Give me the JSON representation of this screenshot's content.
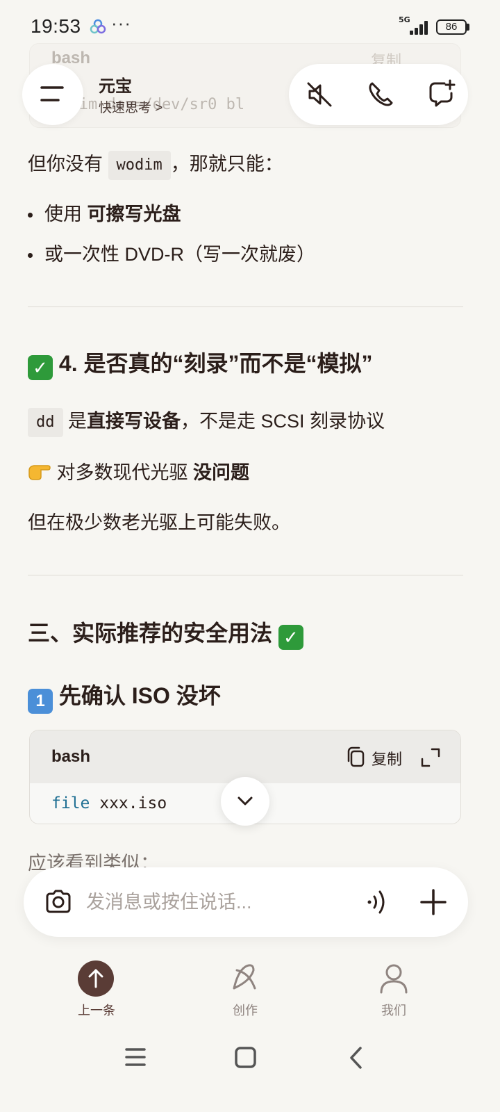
{
  "status_bar": {
    "time": "19:53",
    "more": "···",
    "network": "5G",
    "battery": "86"
  },
  "ghost": {
    "lang": "bash",
    "copy": "复制",
    "code": "wodim dev=/dev/sr0 bl"
  },
  "header": {
    "title": "元宝",
    "subtitle": "快速思考 >"
  },
  "content": {
    "p1_prefix": "但你没有",
    "p1_code": "wodim",
    "p1_suffix": "，那就只能：",
    "bullet1_prefix": "使用 ",
    "bullet1_bold": "可擦写光盘",
    "bullet2": "或一次性 DVD-R（写一次就废）",
    "h4_title": "4. 是否真的“刻录”而不是“模拟”",
    "p2_code": "dd",
    "p2_mid": " 是",
    "p2_bold": "直接写设备",
    "p2_suffix": "，不是走 SCSI 刻录协议",
    "p3_prefix": "对多数现代光驱 ",
    "p3_bold": "没问题",
    "p4": "但在极少数老光驱上可能失败。",
    "h3_title": "三、实际推荐的安全用法",
    "h_step_title": "先确认 ISO 没坏",
    "code_lang": "bash",
    "copy_label": "复制",
    "code_keyword": "file",
    "code_rest": " xxx.iso",
    "fade_text": "应该看到类似："
  },
  "input": {
    "placeholder": "发消息或按住说话..."
  },
  "bottom_nav": [
    {
      "label": "上一条",
      "icon": "arrow-up-icon",
      "color": "#5a3c36"
    },
    {
      "label": "创作",
      "icon": "create-icon",
      "color": "#8f8480"
    },
    {
      "label": "我们",
      "icon": "person-icon",
      "color": "#8f8480"
    }
  ],
  "colors": {
    "background": "#f7f6f2",
    "text": "#2b1e1a",
    "accent": "#5a3c36",
    "code_keyword": "#1f6f93"
  }
}
